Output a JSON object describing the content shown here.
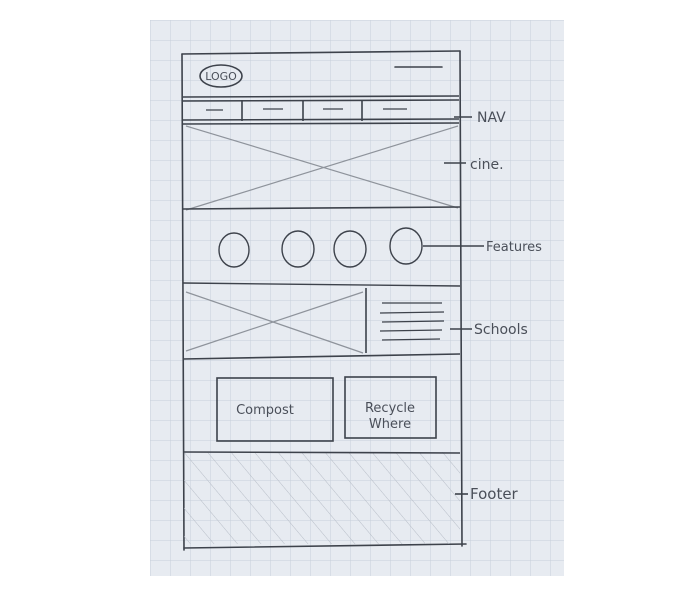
{
  "logo_text": "LOGO",
  "annotations": {
    "nav": "NAV",
    "cine": "cine.",
    "features": "Features",
    "schools": "Schools",
    "footer": "Footer"
  },
  "buttons": {
    "compost": "Compost",
    "recycle_line1": "Recycle",
    "recycle_line2": "Where"
  },
  "colors": {
    "paper": "#e7ebf1",
    "grid": "#c7cfda",
    "pencil": "#3d424b"
  }
}
